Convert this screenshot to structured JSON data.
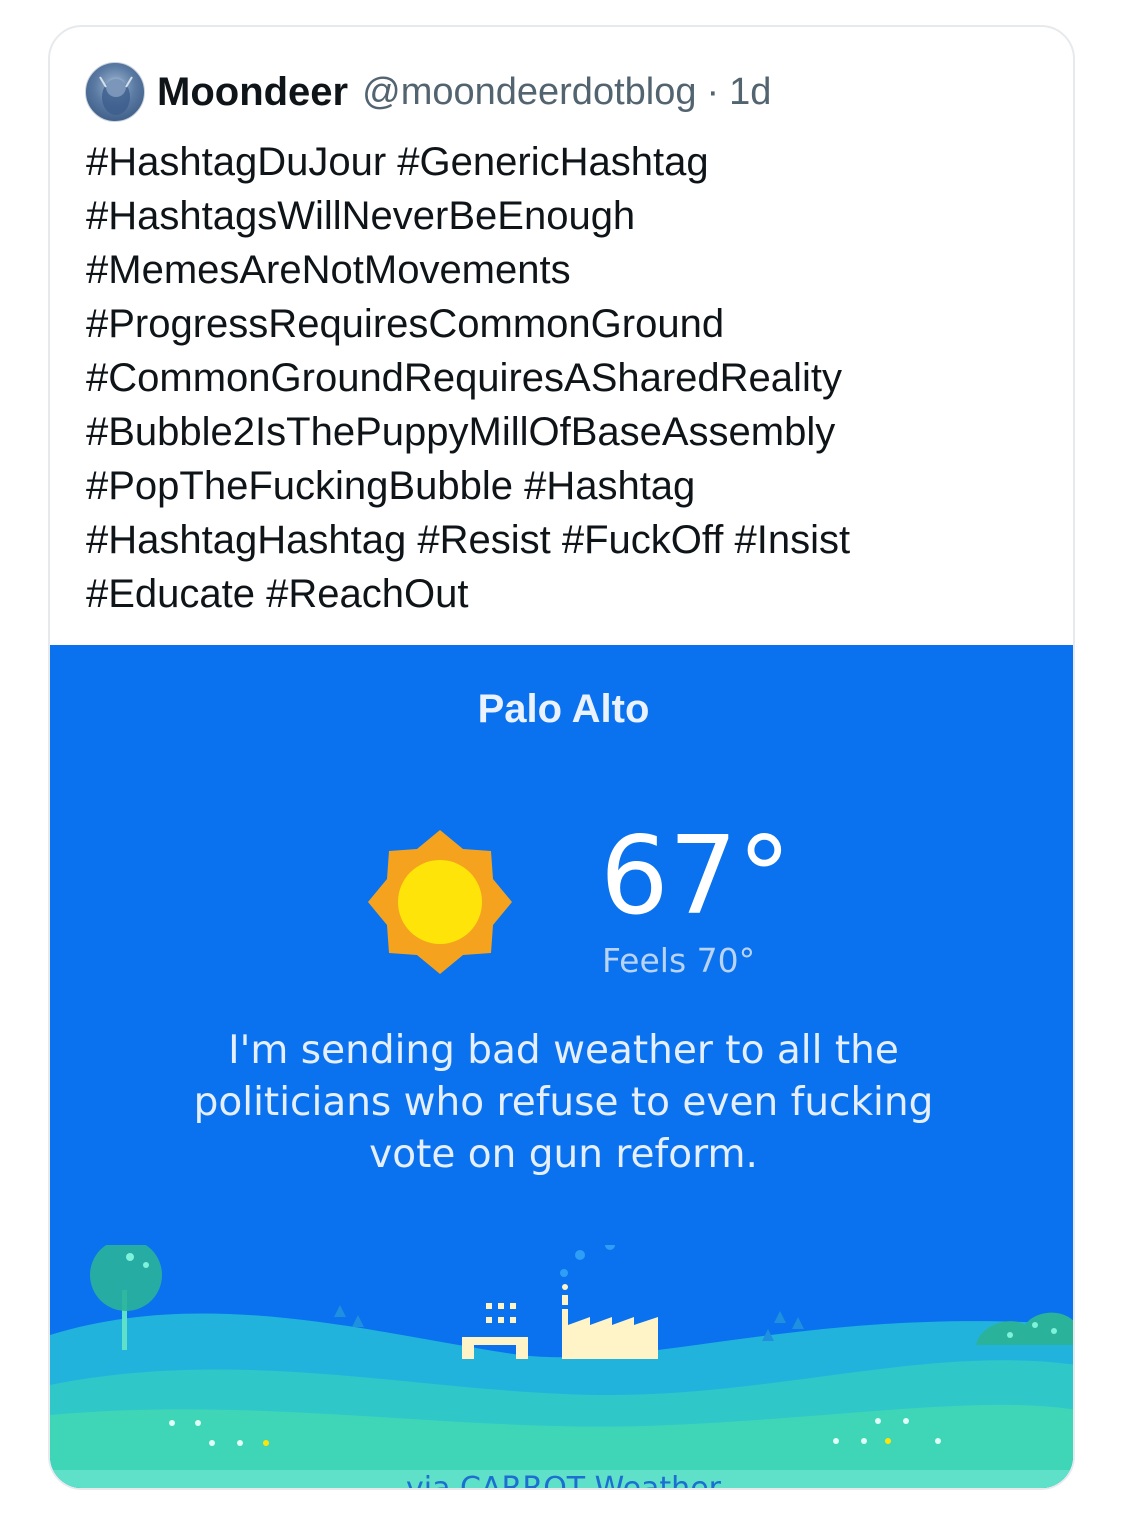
{
  "tweet": {
    "author_name": "Moondeer",
    "handle": "@moondeerdotblog",
    "separator": "·",
    "time": "1d",
    "text_lines": [
      "#HashtagDuJour #GenericHashtag",
      "#HashtagsWillNeverBeEnough",
      "#MemesAreNotMovements",
      "#ProgressRequiresCommonGround",
      "#CommonGroundRequiresASharedReality",
      "#Bubble2IsThePuppyMillOfBaseAssembly",
      "#PopTheFuckingBubble #Hashtag",
      "#HashtagHashtag #Resist #FuckOff #Insist",
      "#Educate #ReachOut"
    ]
  },
  "weather": {
    "city": "Palo Alto",
    "temperature": "67°",
    "feels_like": "Feels 70°",
    "message": "I'm sending bad weather to all the politicians who refuse to even fucking vote on gun reform.",
    "via_prefix": "via ",
    "via_brand": "CARROT Weather",
    "icon": "sun-icon",
    "colors": {
      "background": "#0a72ee",
      "sun_outer": "#f5a31f",
      "sun_inner": "#ffe40a",
      "hill_teal": "#3fd6b8"
    }
  }
}
